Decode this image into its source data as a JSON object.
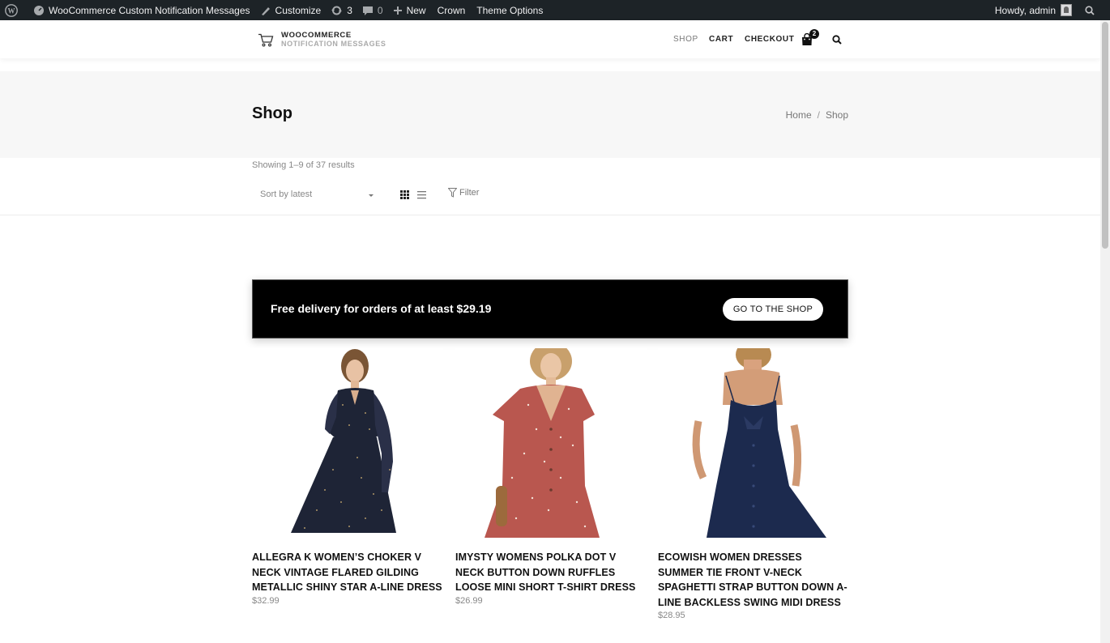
{
  "admin_bar": {
    "site_name": "WooCommerce Custom Notification Messages",
    "customize": "Customize",
    "updates_count": "3",
    "comments_count": "0",
    "new_label": "New",
    "crown": "Crown",
    "theme_options": "Theme Options",
    "howdy": "Howdy, admin"
  },
  "header": {
    "logo_line1": "WOOCOMMERCE",
    "logo_line2": "NOTIFICATION MESSAGES",
    "nav": [
      "SHOP",
      "CART",
      "CHECKOUT"
    ],
    "active_nav": "SHOP",
    "cart_count": "2"
  },
  "page": {
    "title": "Shop",
    "breadcrumb_home": "Home",
    "breadcrumb_sep": "/",
    "breadcrumb_current": "Shop"
  },
  "toolbar": {
    "result_count": "Showing 1–9 of 37 results",
    "sort_selected": "Sort by latest",
    "filter_label": "Filter"
  },
  "notice": {
    "text": "Free delivery for orders of at least $29.19",
    "button": "GO TO THE SHOP"
  },
  "products": [
    {
      "title": "ALLEGRA K WOMEN’S CHOKER V NECK VINTAGE FLARED GILDING METALLIC SHINY STAR A-LINE DRESS",
      "price": "$32.99",
      "dress_color": "#1e2436"
    },
    {
      "title": "IMYSTY WOMENS POLKA DOT V NECK BUTTON DOWN RUFFLES LOOSE MINI SHORT T-SHIRT DRESS",
      "price": "$26.99",
      "dress_color": "#b9574f"
    },
    {
      "title": "ECOWISH WOMEN DRESSES SUMMER TIE FRONT V-NECK SPAGHETTI STRAP BUTTON DOWN A-LINE BACKLESS SWING MIDI DRESS",
      "price": "$28.95",
      "dress_color": "#1c2a4e"
    }
  ]
}
